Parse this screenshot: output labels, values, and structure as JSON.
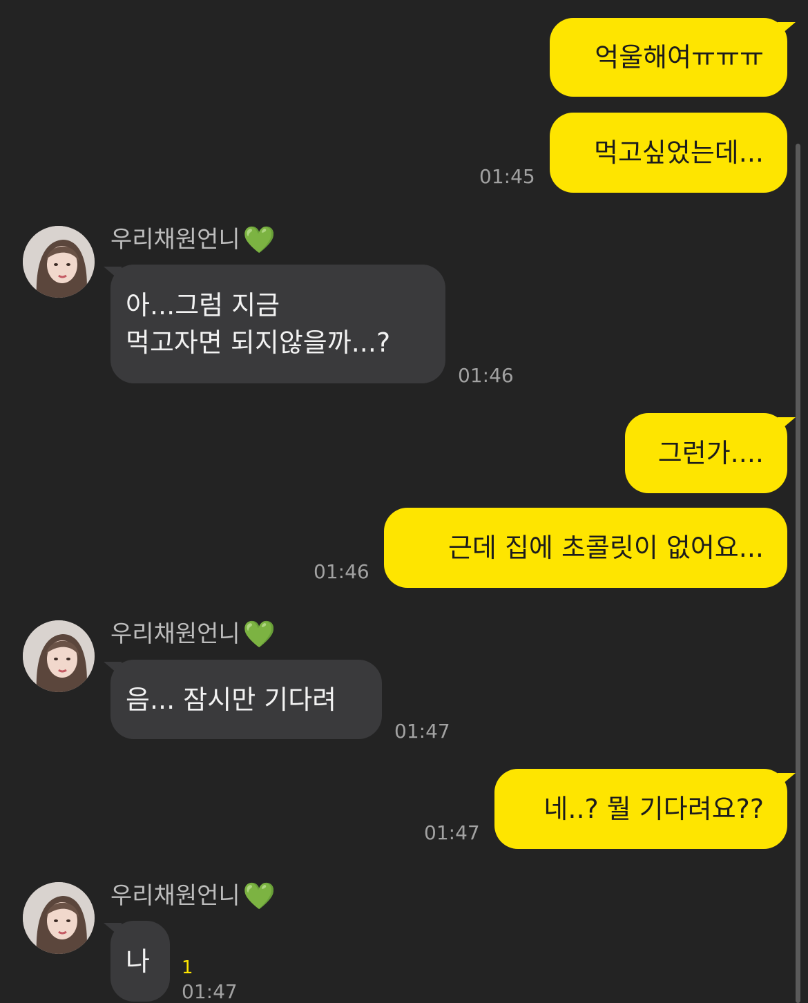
{
  "contact": {
    "name": "우리채원언니",
    "heart": "💚"
  },
  "colors": {
    "background": "#232323",
    "my_bubble": "#FEE500",
    "their_bubble": "#3a3a3c",
    "time": "#a2a2a2",
    "unread": "#FEE500"
  },
  "messages": [
    {
      "from": "me",
      "text": "억울해여ㅠㅠㅠ"
    },
    {
      "from": "me",
      "text": "먹고싶었는데...",
      "time": "01:45"
    },
    {
      "from": "them",
      "lines": [
        "아...그럼 지금",
        "먹고자면 되지않을까...?"
      ],
      "time": "01:46"
    },
    {
      "from": "me",
      "text": "그런가...."
    },
    {
      "from": "me",
      "text": "근데 집에 초콜릿이 없어요...",
      "time": "01:46"
    },
    {
      "from": "them",
      "text": "음... 잠시만 기다려",
      "time": "01:47"
    },
    {
      "from": "me",
      "text": "네..? 뭘 기다려요??",
      "time": "01:47"
    },
    {
      "from": "them",
      "text": "나",
      "unread": "1",
      "time": "01:47"
    }
  ]
}
